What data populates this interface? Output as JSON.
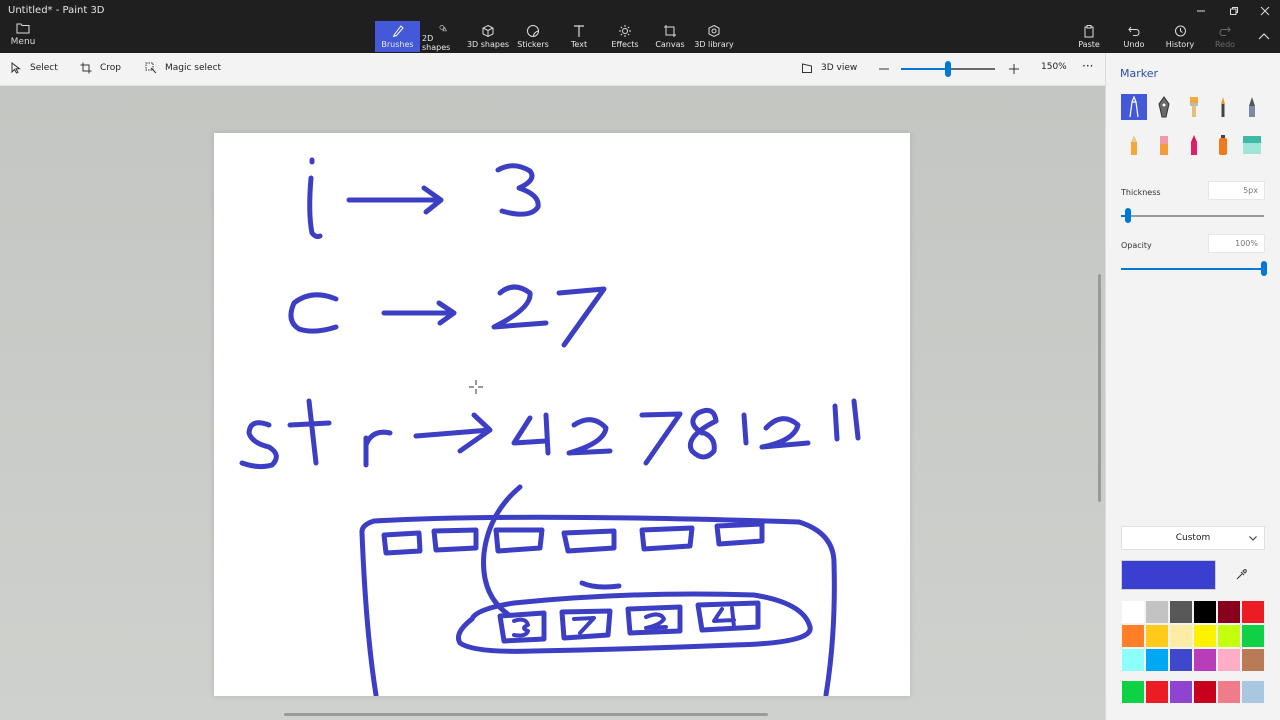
{
  "window": {
    "title": "Untitled* - Paint 3D"
  },
  "menu": {
    "label": "Menu"
  },
  "ribbon": {
    "tools": [
      {
        "label": "Brushes",
        "icon": "brush-icon"
      },
      {
        "label": "2D shapes",
        "icon": "2d-shapes-icon"
      },
      {
        "label": "3D shapes",
        "icon": "3d-shapes-icon"
      },
      {
        "label": "Stickers",
        "icon": "stickers-icon"
      },
      {
        "label": "Text",
        "icon": "text-icon"
      },
      {
        "label": "Effects",
        "icon": "effects-icon"
      },
      {
        "label": "Canvas",
        "icon": "canvas-icon"
      },
      {
        "label": "3D library",
        "icon": "3d-library-icon"
      }
    ],
    "actions": [
      {
        "label": "Paste",
        "icon": "paste-icon"
      },
      {
        "label": "Undo",
        "icon": "undo-icon"
      },
      {
        "label": "History",
        "icon": "history-icon"
      },
      {
        "label": "Redo",
        "icon": "redo-icon"
      }
    ]
  },
  "subtoolbar": {
    "select": "Select",
    "crop": "Crop",
    "magic_select": "Magic select",
    "view_3d": "3D view",
    "zoom": "150%",
    "zoom_fraction": 0.5
  },
  "panel": {
    "title": "Marker",
    "brushes": [
      "marker-icon",
      "calligraphy-pen-icon",
      "oil-brush-icon",
      "watercolor-icon",
      "pixel-pen-icon",
      "pencil-icon",
      "eraser-icon",
      "crayon-icon",
      "spray-can-icon",
      "fill-icon"
    ],
    "thickness": {
      "label": "Thickness",
      "value": "5px",
      "fraction": 0.05
    },
    "opacity": {
      "label": "Opacity",
      "value": "100%",
      "fraction": 1.0
    },
    "color_mode": "Custom",
    "current_color": "#3a3fd0",
    "palette": [
      "#ffffff",
      "#c3c3c3",
      "#585858",
      "#000000",
      "#88001b",
      "#ec1c24",
      "#ff7f27",
      "#ffca18",
      "#fdeca6",
      "#fff200",
      "#c4ff0e",
      "#0ed145",
      "#8cfffb",
      "#00a8f3",
      "#3f48cc",
      "#b83dba",
      "#ffaec8",
      "#b97a56"
    ],
    "custom_palette": [
      "#0ed145",
      "#ec1c24",
      "#8e44d1",
      "#c8001e",
      "#f17c89",
      "#a9c7e1"
    ]
  }
}
